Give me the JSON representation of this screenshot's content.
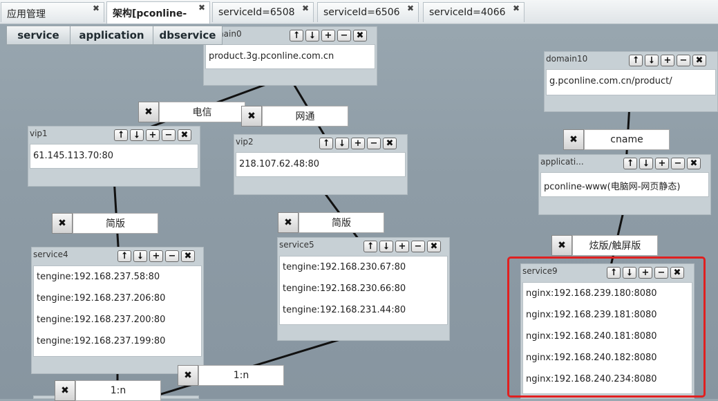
{
  "tabs": [
    {
      "label": "应用管理"
    },
    {
      "label": "架构[pconline-"
    },
    {
      "label": "serviceId=6508"
    },
    {
      "label": "serviceId=6506"
    },
    {
      "label": "serviceId=4066"
    }
  ],
  "toolbar": {
    "service": "service",
    "application": "application",
    "dbservice": "dbservice"
  },
  "controls": {
    "up": "⭡",
    "down": "⭣",
    "add": "+",
    "remove": "−",
    "close": "✖"
  },
  "nodes": {
    "domain0": {
      "title": "domain0",
      "rows": [
        "product.3g.pconline.com.cn"
      ]
    },
    "domain10": {
      "title": "domain10",
      "rows": [
        "g.pconline.com.cn/product/"
      ]
    },
    "vip1": {
      "title": "vip1",
      "rows": [
        "61.145.113.70:80"
      ]
    },
    "vip2": {
      "title": "vip2",
      "rows": [
        "218.107.62.48:80"
      ]
    },
    "application": {
      "title": "applicati...",
      "rows": [
        "pconline-www(电脑网-网页静态)"
      ]
    },
    "service4": {
      "title": "service4",
      "rows": [
        "tengine:192.168.237.58:80",
        "tengine:192.168.237.206:80",
        "tengine:192.168.237.200:80",
        "tengine:192.168.237.199:80"
      ]
    },
    "service5": {
      "title": "service5",
      "rows": [
        "tengine:192.168.230.67:80",
        "tengine:192.168.230.66:80",
        "tengine:192.168.231.44:80"
      ]
    },
    "service9": {
      "title": "service9",
      "rows": [
        "nginx:192.168.239.180:8080",
        "nginx:192.168.239.181:8080",
        "nginx:192.168.240.181:8080",
        "nginx:192.168.240.182:8080",
        "nginx:192.168.240.234:8080"
      ]
    }
  },
  "links": {
    "dianxin": "电信",
    "wangtong": "网通",
    "cname": "cname",
    "jianban1": "简版",
    "jianban2": "简版",
    "xuanban": "炫版/触屏版",
    "one_n_a": "1:n",
    "one_n_b": "1:n"
  },
  "colors": {
    "highlight": "#e02020",
    "canvas": "#8e9ca6"
  }
}
